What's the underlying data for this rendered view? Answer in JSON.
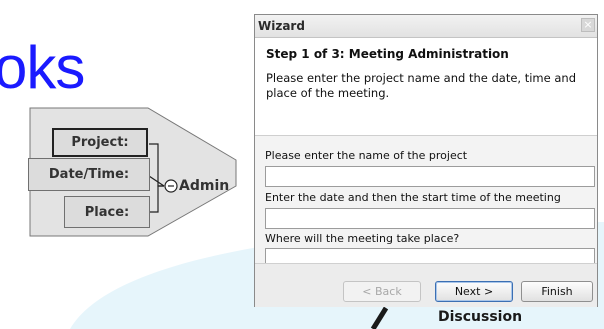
{
  "background": {
    "word_fragment": "oks",
    "diagram": {
      "fields": [
        "Project:",
        "Date/Time:",
        "Place:"
      ],
      "group_label": "Admin",
      "node_label": "Discussion"
    }
  },
  "wizard": {
    "title": "Wizard",
    "close_glyph": "×",
    "step_title": "Step 1 of 3: Meeting Administration",
    "step_description": "Please enter the project name and the date, time and place of the meeting.",
    "fields": [
      {
        "label": "Please enter the name of the project",
        "value": "",
        "placeholder": ""
      },
      {
        "label": "Enter the date and then the start time of the meeting",
        "value": "",
        "placeholder": ""
      },
      {
        "label": "Where will the meeting take place?",
        "value": "",
        "placeholder": ""
      }
    ],
    "buttons": {
      "back": "< Back",
      "next": "Next >",
      "finish": "Finish"
    }
  },
  "colors": {
    "word_fragment": "#1a1aff",
    "diagram_fill": "#dcdcdc",
    "guide_fill": "#e6f5fb",
    "dark_line": "#222222"
  }
}
